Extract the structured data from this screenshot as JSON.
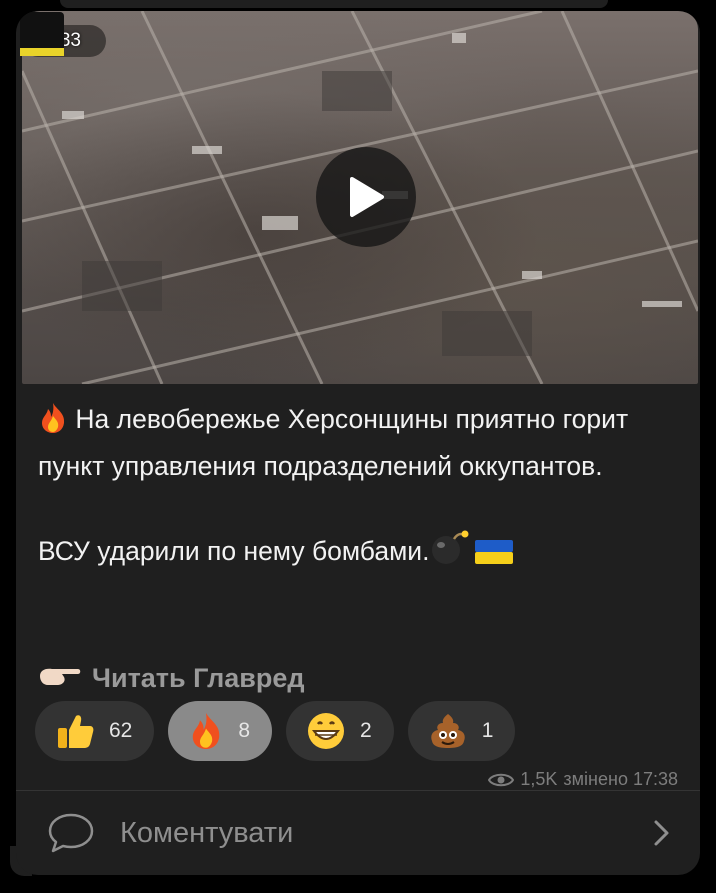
{
  "video": {
    "duration": "0:33"
  },
  "post": {
    "paragraph1": "На левобережье Херсонщины приятно горит пункт управления подразделений оккупантов.",
    "paragraph2": "ВСУ ударили по нему бомбами."
  },
  "link": {
    "label": "Читать Главред"
  },
  "reactions": [
    {
      "icon": "thumbs-up-icon",
      "count": "62"
    },
    {
      "icon": "fire-icon",
      "count": "8"
    },
    {
      "icon": "grinning-face-icon",
      "count": "2"
    },
    {
      "icon": "pile-of-poo-icon",
      "count": "1"
    }
  ],
  "meta": {
    "views": "1,5K",
    "edited": "змінено 17:38"
  },
  "comment": {
    "label": "Коментувати"
  },
  "colors": {
    "bubble": "#1f1f1f",
    "reaction_active": "#8a8a8a",
    "flag_blue": "#1e5cc8",
    "flag_yellow": "#f5cf1a"
  }
}
